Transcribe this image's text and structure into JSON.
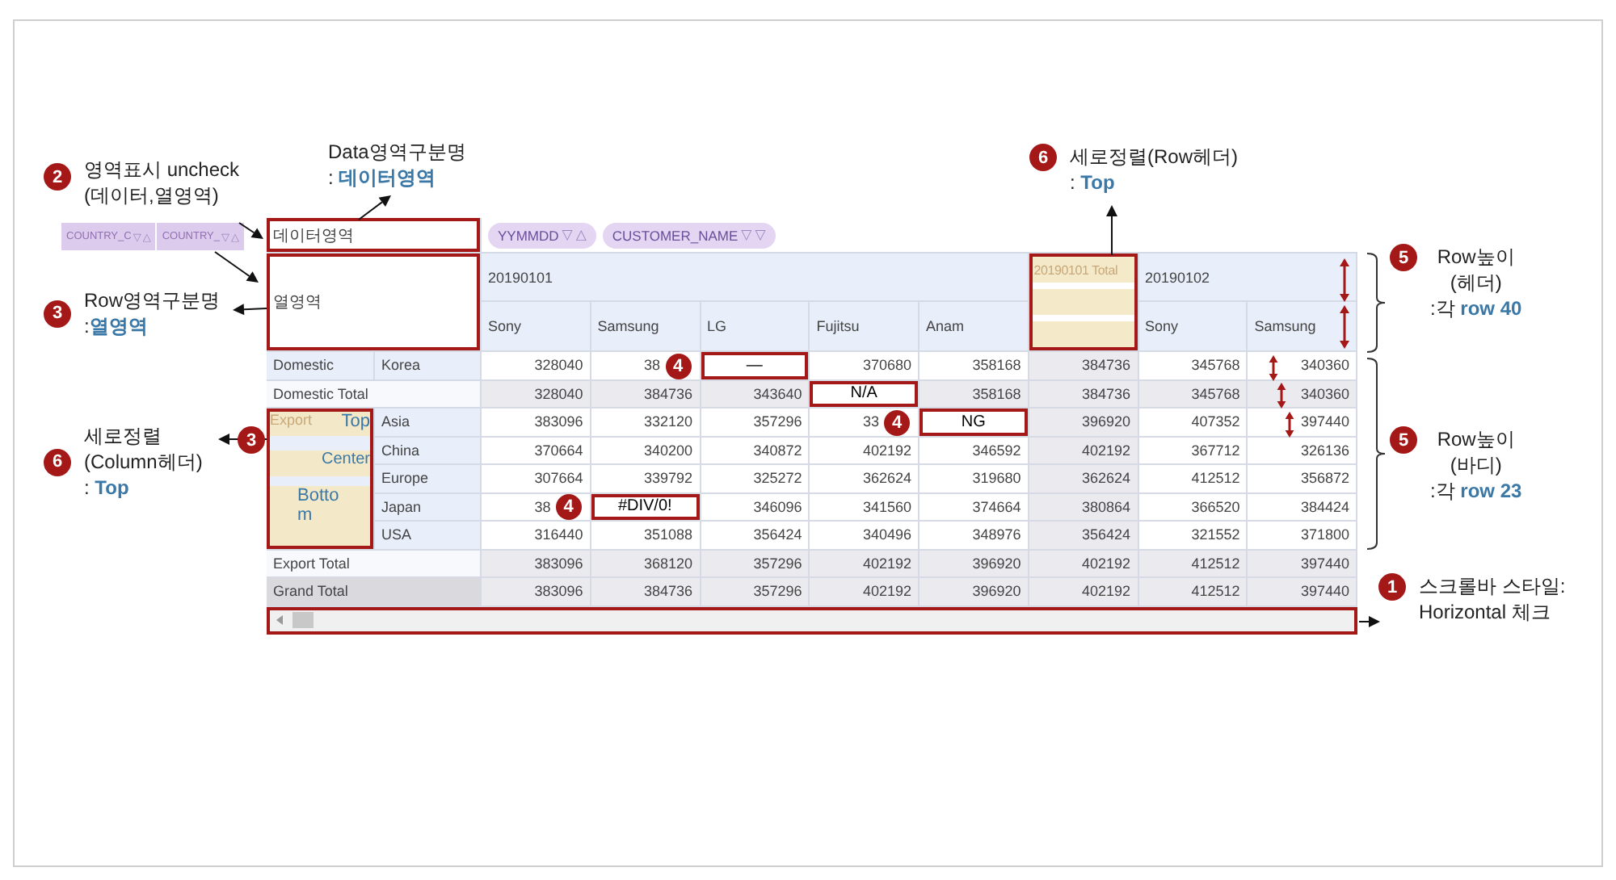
{
  "row_field_chips": [
    {
      "label": "COUNTRY_C",
      "filter_glyph": "▽",
      "sort_glyph": "△"
    },
    {
      "label": "COUNTRY_",
      "filter_glyph": "▽",
      "sort_glyph": "△"
    }
  ],
  "grid": {
    "data_area": {
      "label": "데이터영역",
      "highlighted": true
    },
    "column_field_chips": [
      {
        "label": "YYMMDD",
        "filter_glyph": "▽",
        "sort_glyph": "△"
      },
      {
        "label": "CUSTOMER_NAME",
        "filter_glyph": "▽",
        "sort_glyph": "▽"
      }
    ],
    "row_area": {
      "label": "열영역",
      "highlighted": true
    },
    "column_headers": [
      {
        "label": "20190101",
        "kind": "date",
        "highlighted": false,
        "children": [
          "Sony",
          "Samsung",
          "LG",
          "Fujitsu",
          "Anam"
        ]
      },
      {
        "label": "20190101 Total",
        "kind": "total",
        "highlighted": true
      },
      {
        "label": "20190102",
        "kind": "date",
        "highlighted": false,
        "children": [
          "Sony",
          "Samsung"
        ]
      }
    ],
    "row_groups": [
      {
        "label": "Domestic",
        "kind": "group",
        "highlighted": false,
        "members": [
          {
            "label": "Korea",
            "cells": [
              {
                "text": "328040",
                "boxed": false
              },
              {
                "text": "38",
                "boxed": false,
                "badge": "4"
              },
              {
                "text": "—",
                "boxed": true
              },
              {
                "text": "370680",
                "boxed": false
              },
              {
                "text": "358168",
                "boxed": false
              },
              {
                "text": "384736",
                "boxed": false
              },
              {
                "text": "345768",
                "boxed": false
              },
              {
                "text": "340360",
                "boxed": false
              }
            ]
          }
        ]
      },
      {
        "label": "Domestic Total",
        "kind": "total",
        "cells": [
          {
            "text": "328040",
            "boxed": false
          },
          {
            "text": "384736",
            "boxed": false
          },
          {
            "text": "343640",
            "boxed": false
          },
          {
            "text": "N/A",
            "boxed": true
          },
          {
            "text": "358168",
            "boxed": false
          },
          {
            "text": "384736",
            "boxed": false
          },
          {
            "text": "345768",
            "boxed": false
          },
          {
            "text": "340360",
            "boxed": false
          }
        ]
      },
      {
        "label": "Export",
        "kind": "group",
        "highlighted": true,
        "alignment_labels": [
          "Top",
          "Center",
          "Bottom"
        ],
        "members": [
          {
            "label": "Asia",
            "cells": [
              {
                "text": "383096",
                "boxed": false
              },
              {
                "text": "332120",
                "boxed": false
              },
              {
                "text": "357296",
                "boxed": false
              },
              {
                "text": "33",
                "boxed": false,
                "badge": "4"
              },
              {
                "text": "NG",
                "boxed": true
              },
              {
                "text": "396920",
                "boxed": false
              },
              {
                "text": "407352",
                "boxed": false
              },
              {
                "text": "397440",
                "boxed": false
              }
            ]
          },
          {
            "label": "China",
            "cells": [
              {
                "text": "370664",
                "boxed": false
              },
              {
                "text": "340200",
                "boxed": false
              },
              {
                "text": "340872",
                "boxed": false
              },
              {
                "text": "402192",
                "boxed": false
              },
              {
                "text": "346592",
                "boxed": false
              },
              {
                "text": "402192",
                "boxed": false
              },
              {
                "text": "367712",
                "boxed": false
              },
              {
                "text": "326136",
                "boxed": false
              }
            ]
          },
          {
            "label": "Europe",
            "cells": [
              {
                "text": "307664",
                "boxed": false
              },
              {
                "text": "339792",
                "boxed": false
              },
              {
                "text": "325272",
                "boxed": false
              },
              {
                "text": "362624",
                "boxed": false
              },
              {
                "text": "319680",
                "boxed": false
              },
              {
                "text": "362624",
                "boxed": false
              },
              {
                "text": "412512",
                "boxed": false
              },
              {
                "text": "356872",
                "boxed": false
              }
            ]
          },
          {
            "label": "Japan",
            "cells": [
              {
                "text": "38",
                "boxed": false,
                "badge": "4"
              },
              {
                "text": "#DIV/0!",
                "boxed": true
              },
              {
                "text": "346096",
                "boxed": false
              },
              {
                "text": "341560",
                "boxed": false
              },
              {
                "text": "374664",
                "boxed": false
              },
              {
                "text": "380864",
                "boxed": false
              },
              {
                "text": "366520",
                "boxed": false
              },
              {
                "text": "384424",
                "boxed": false
              }
            ]
          },
          {
            "label": "USA",
            "cells": [
              {
                "text": "316440",
                "boxed": false
              },
              {
                "text": "351088",
                "boxed": false
              },
              {
                "text": "356424",
                "boxed": false
              },
              {
                "text": "340496",
                "boxed": false
              },
              {
                "text": "348976",
                "boxed": false
              },
              {
                "text": "356424",
                "boxed": false
              },
              {
                "text": "321552",
                "boxed": false
              },
              {
                "text": "371800",
                "boxed": false
              }
            ]
          }
        ]
      },
      {
        "label": "Export Total",
        "kind": "total",
        "cells": [
          {
            "text": "383096",
            "boxed": false
          },
          {
            "text": "368120",
            "boxed": false
          },
          {
            "text": "357296",
            "boxed": false
          },
          {
            "text": "402192",
            "boxed": false
          },
          {
            "text": "396920",
            "boxed": false
          },
          {
            "text": "402192",
            "boxed": false
          },
          {
            "text": "412512",
            "boxed": false
          },
          {
            "text": "397440",
            "boxed": false
          }
        ]
      },
      {
        "label": "Grand Total",
        "kind": "grand",
        "cells": [
          {
            "text": "383096",
            "boxed": false
          },
          {
            "text": "384736",
            "boxed": false
          },
          {
            "text": "357296",
            "boxed": false
          },
          {
            "text": "402192",
            "boxed": false
          },
          {
            "text": "396920",
            "boxed": false
          },
          {
            "text": "402192",
            "boxed": false
          },
          {
            "text": "412512",
            "boxed": false
          },
          {
            "text": "397440",
            "boxed": false
          }
        ]
      }
    ],
    "scrollbar": {
      "highlighted": true
    }
  },
  "annotations": [
    {
      "badge": "2",
      "lines": [
        "영역표시 uncheck",
        "(데이터,열영역)"
      ]
    },
    {
      "lines": [
        "Data영역구분명",
        ": **데이터영역**"
      ]
    },
    {
      "badge": "3",
      "lines": [
        "Row영역구분명",
        ":**열영역**"
      ]
    },
    {
      "badge": "6",
      "lines": [
        "세로정렬",
        "(Column헤더)",
        ": **Top**"
      ]
    },
    {
      "badge": "3"
    },
    {
      "badge": "6",
      "lines": [
        "세로정렬(Row헤더)",
        ": **Top**"
      ]
    },
    {
      "badge": "5",
      "lines": [
        "Row높이",
        "(헤더)",
        ":각 **row 40**"
      ]
    },
    {
      "badge": "5",
      "lines": [
        "Row높이",
        "(바디)",
        ":각 **row 23**"
      ]
    },
    {
      "badge": "1",
      "lines": [
        "스크롤바 스타일:",
        "Horizontal 체크"
      ]
    }
  ]
}
